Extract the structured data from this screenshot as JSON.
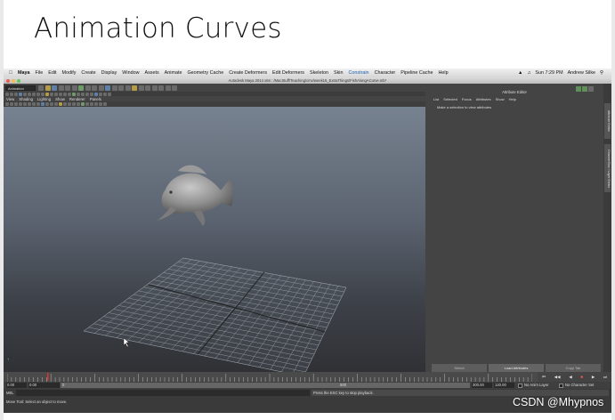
{
  "slide": {
    "title": "Animation Curves"
  },
  "mac_menu": {
    "app": "Maya",
    "items": [
      "File",
      "Edit",
      "Modify",
      "Create",
      "Display",
      "Window",
      "Assets",
      "Animate",
      "Geometry Cache",
      "Create Deformers",
      "Edit Deformers",
      "Skeleton",
      "Skin",
      "Constrain",
      "Character",
      "Pipeline Cache",
      "Help"
    ],
    "clock": "Sun 7:29 PM",
    "user": "Andrew Silke"
  },
  "window_title": "Autodesk Maya 2014 x64 : /MacStuff/Teaching/cmv/week15_ExtraThings/FishAlongACurve.mb*",
  "status_line": {
    "mode": "Animation"
  },
  "panel_menu": [
    "View",
    "Shading",
    "Lighting",
    "Show",
    "Renderer",
    "Panels"
  ],
  "attribute_editor": {
    "title": "Attribute Editor",
    "menu": [
      "List",
      "Selected",
      "Focus",
      "Attributes",
      "Show",
      "Help"
    ],
    "message": "Make a selection to view attributes",
    "buttons": [
      "Select",
      "Load Attributes",
      "Copy Tab"
    ]
  },
  "side_tabs": [
    "Attribute Editor",
    "Channel Box / Layer Editor"
  ],
  "time_range": {
    "start": "0.00",
    "start_inner": "0.00",
    "slider_left": "0",
    "slider_mid": "500",
    "end_inner": "300.00",
    "end": "120.00",
    "anim_layer": "No Anim Layer",
    "character_set": "No Character Set"
  },
  "command_line": {
    "label": "MEL",
    "output": "Press the ESC key to stop playback."
  },
  "help_line": "Move Tool: Select an object to move.",
  "watermark": "CSDN @Mhypnos",
  "colors": {
    "viewport_top": "#7a8593",
    "viewport_bottom": "#2f3135",
    "panel": "#444444"
  }
}
